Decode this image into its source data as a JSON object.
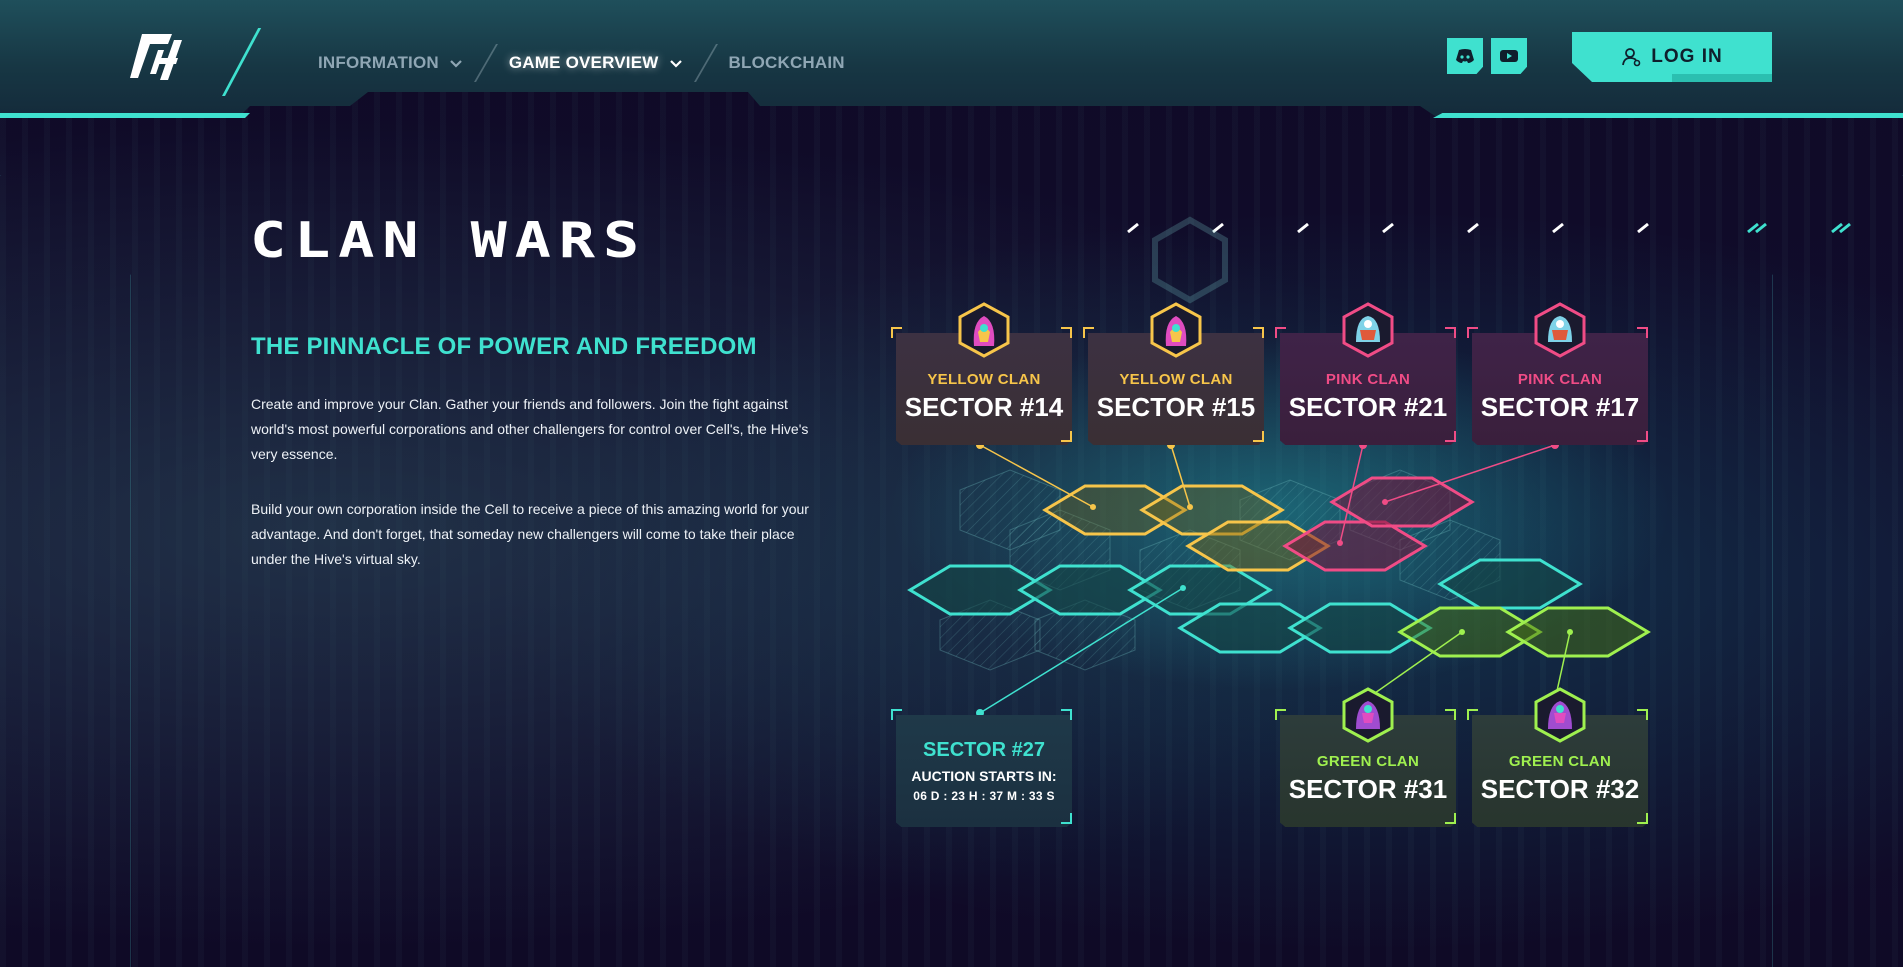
{
  "colors": {
    "accent": "#3fe1cf",
    "yellow_clan": "#f7c54a",
    "pink_clan": "#f04c86",
    "green_clan": "#9ff04f",
    "background": "#0f0a26"
  },
  "header": {
    "logo_icon": "ph-logo-icon",
    "nav": [
      {
        "label": "INFORMATION",
        "has_dropdown": true,
        "active": false
      },
      {
        "label": "GAME OVERVIEW",
        "has_dropdown": true,
        "active": true
      },
      {
        "label": "BLOCKCHAIN",
        "has_dropdown": false,
        "active": false
      }
    ],
    "social": [
      {
        "icon": "discord-icon"
      },
      {
        "icon": "youtube-icon"
      }
    ],
    "login_label": "LOG IN",
    "login_icon": "user-icon"
  },
  "hero": {
    "title": "CLAN WARS",
    "subtitle": "THE PINNACLE OF POWER AND FREEDOM",
    "paragraph1": "Create and improve your Clan. Gather your friends and followers. Join the fight against world's most powerful corporations and other challengers for control over Cell's, the Hive's very essence.",
    "paragraph2": "Build your own corporation inside the Cell to receive a piece of this amazing world for your advantage. And don't forget, that someday new challengers will come to take their place under the Hive's virtual sky."
  },
  "sectors": [
    {
      "clan": "YELLOW CLAN",
      "sector": "SECTOR #14",
      "color": "yellow"
    },
    {
      "clan": "YELLOW CLAN",
      "sector": "SECTOR #15",
      "color": "yellow"
    },
    {
      "clan": "PINK CLAN",
      "sector": "SECTOR #21",
      "color": "pink"
    },
    {
      "clan": "PINK CLAN",
      "sector": "SECTOR #17",
      "color": "pink"
    },
    {
      "clan": "GREEN CLAN",
      "sector": "SECTOR #31",
      "color": "green"
    },
    {
      "clan": "GREEN CLAN",
      "sector": "SECTOR #32",
      "color": "green"
    }
  ],
  "auction": {
    "sector": "SECTOR #27",
    "label": "AUCTION STARTS IN:",
    "timer": "06 D : 23 H : 37 M : 33 S"
  }
}
